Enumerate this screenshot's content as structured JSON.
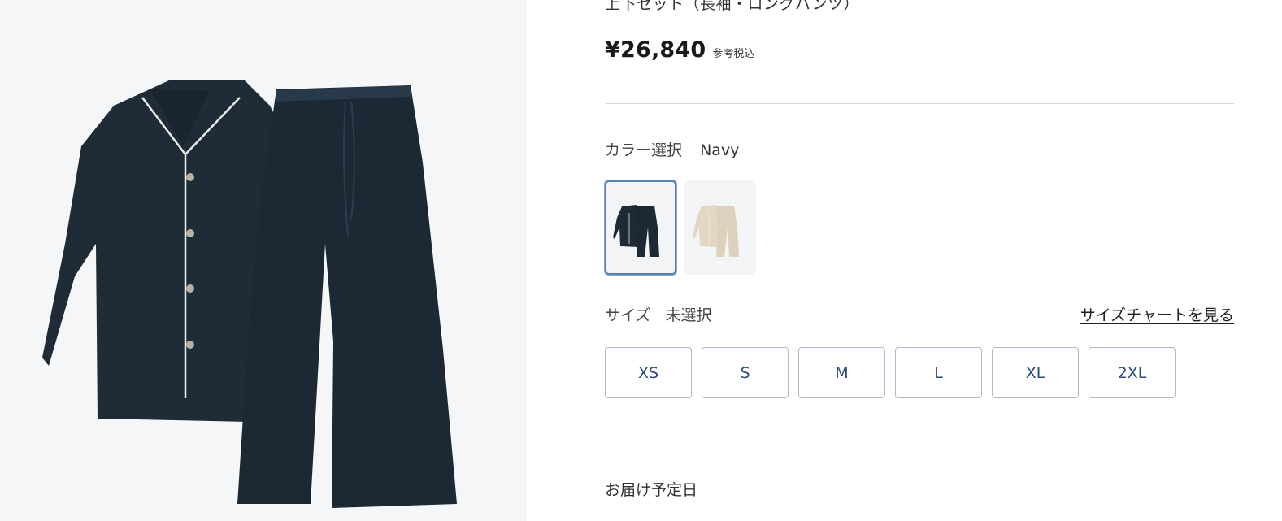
{
  "product": {
    "subtitle": "上下セット（長袖・ロングパンツ）",
    "price": "¥26,840",
    "tax_note": "参考税込",
    "main_image_alt": "Navy pajama set"
  },
  "color": {
    "label": "カラー選択",
    "selected": "Navy",
    "options": [
      {
        "name": "Navy",
        "color": "#1e2a36",
        "selected": true
      },
      {
        "name": "Beige",
        "color": "#e3d6c4",
        "selected": false
      }
    ]
  },
  "size": {
    "label": "サイズ",
    "selected": "未選択",
    "chart_link": "サイズチャートを見る",
    "options": [
      "XS",
      "S",
      "M",
      "L",
      "XL",
      "2XL"
    ]
  },
  "delivery": {
    "label": "お届け予定日"
  },
  "theme": {
    "accent": "#5a7fb6",
    "size_text": "#2a4a7d",
    "garment_navy": "#1e2a36"
  }
}
